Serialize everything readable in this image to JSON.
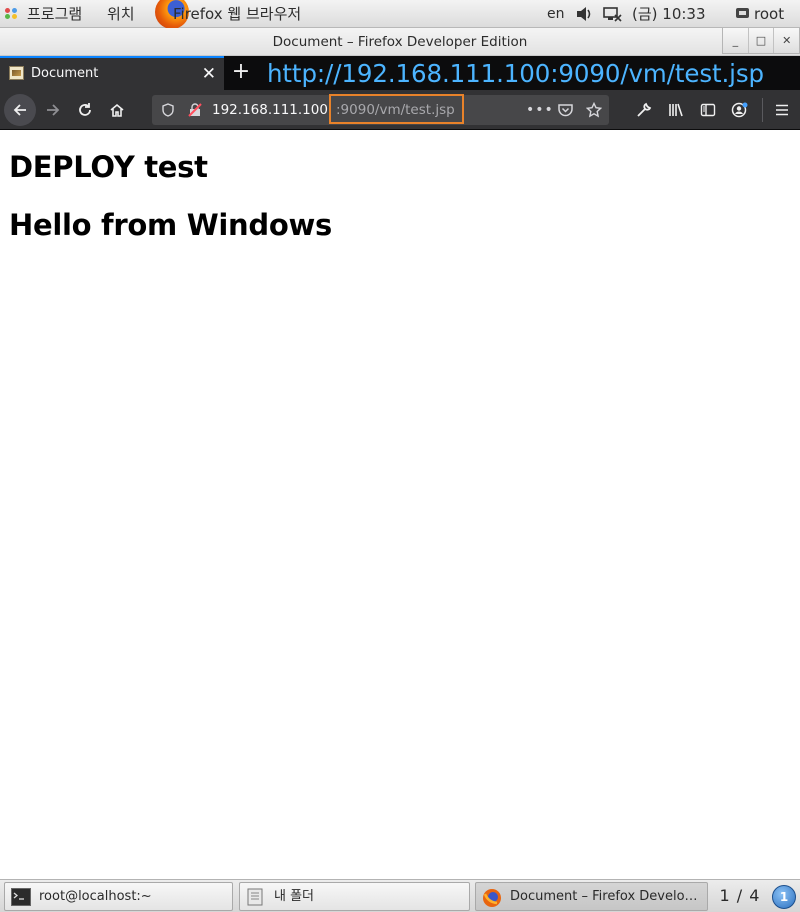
{
  "top_panel": {
    "applications_label": "프로그램",
    "places_label": "위치",
    "firefox_label": "Firefox 웹 브라우저",
    "keyboard_layout": "en",
    "clock": "(금) 10:33",
    "user": "root"
  },
  "window": {
    "title": "Document – Firefox Developer Edition"
  },
  "browser": {
    "tab_title": "Document",
    "overlay_url": "http://192.168.111.100:9090/vm/test.jsp",
    "url_host": "192.168.111.100",
    "url_path": ":9090/vm/test.jsp",
    "accent_color": "#0a84ff",
    "highlight_color": "#e8822a"
  },
  "page": {
    "heading1": "DEPLOY test",
    "heading2": "Hello from Windows"
  },
  "taskbar": {
    "items": [
      {
        "label": "root@localhost:~",
        "icon": "terminal-icon"
      },
      {
        "label": "내 폴더",
        "icon": "folder-icon"
      },
      {
        "label": "Document – Firefox Develo…",
        "icon": "firefox-icon"
      }
    ],
    "workspace": "1 / 4",
    "notification_count": "1"
  }
}
